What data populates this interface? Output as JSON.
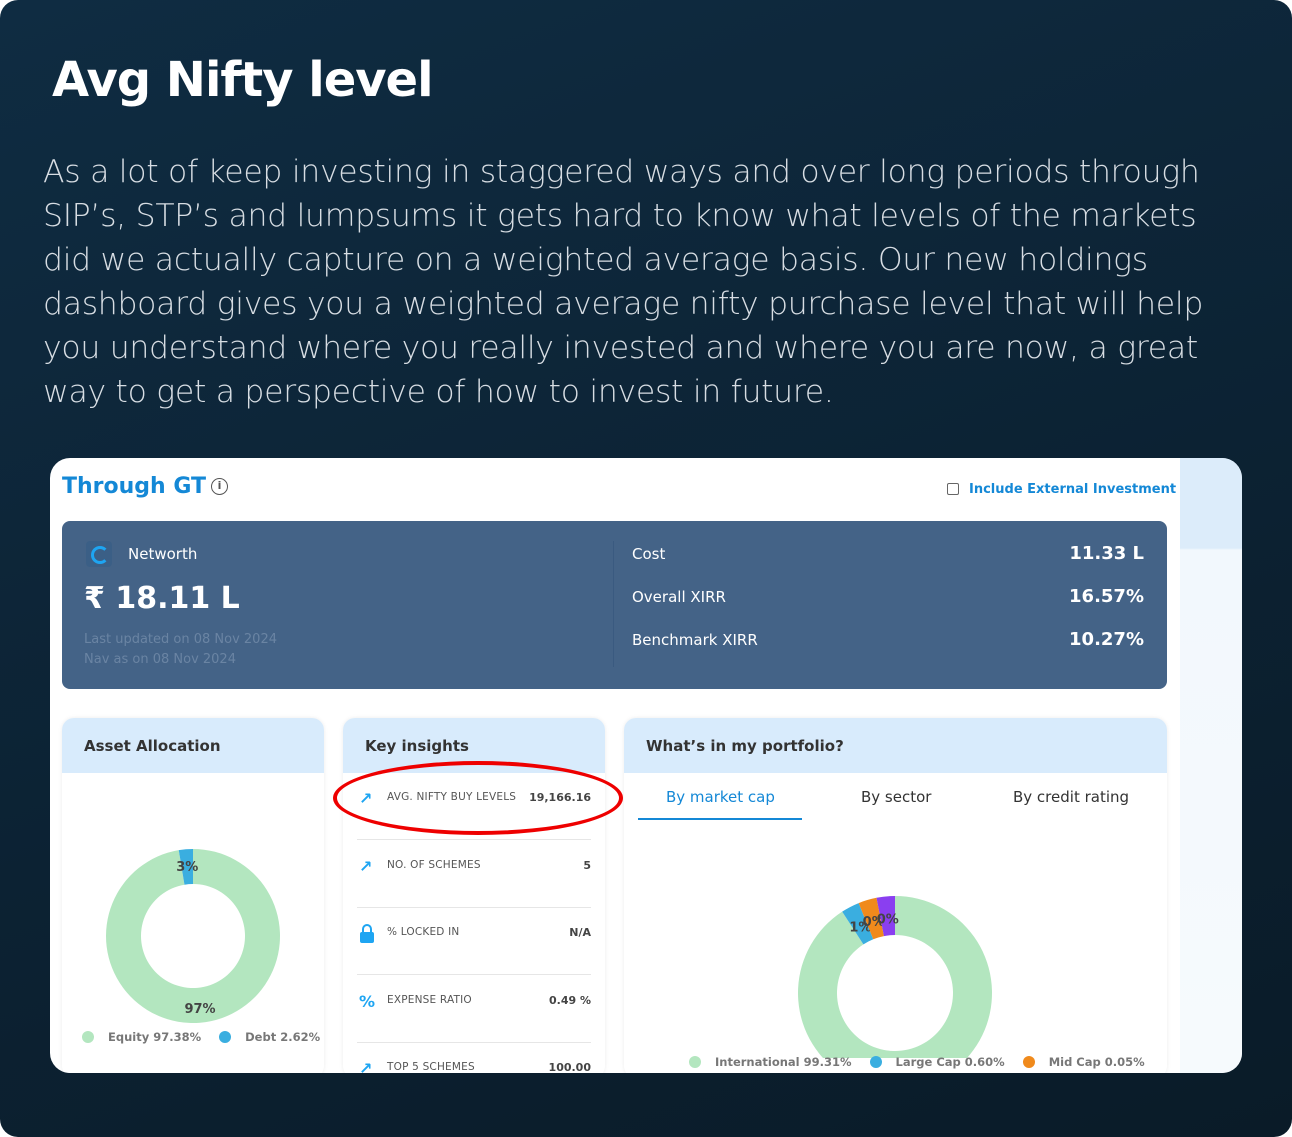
{
  "heading": "Avg Nifty level",
  "paragraph": "As a lot of keep investing in staggered ways and over long periods through SIP’s, STP’s and lumpsums it gets hard to know what levels of the markets did we actually capture on a weighted average basis. Our new holdings dashboard gives you a weighted average nifty purchase level that will help you understand where you really invested and where you are now, a great way to get a perspective of how to invest in future.",
  "card": {
    "title": "Through GT",
    "info_icon": "info-icon",
    "include_external": "Include External Investment",
    "include_external_checked": false,
    "networth": {
      "label": "Networth",
      "value": "₹ 18.11 L",
      "last_updated": "Last updated on 08 Nov 2024",
      "nav_as_on": "Nav as on 08 Nov 2024"
    },
    "stats": [
      {
        "label": "Cost",
        "value": "11.33 L"
      },
      {
        "label": "Overall XIRR",
        "value": "16.57%"
      },
      {
        "label": "Benchmark XIRR",
        "value": "10.27%"
      }
    ],
    "asset_allocation": {
      "title": "Asset Allocation"
    },
    "key_insights": {
      "title": "Key insights",
      "rows": [
        {
          "icon": "trending-up-icon",
          "label": "AVG. NIFTY BUY LEVELS",
          "value": "19,166.16"
        },
        {
          "icon": "trending-up-icon",
          "label": "NO. OF SCHEMES",
          "value": "5"
        },
        {
          "icon": "lock-icon",
          "label": "% LOCKED IN",
          "value": "N/A"
        },
        {
          "icon": "percent-icon",
          "label": "EXPENSE RATIO",
          "value": "0.49 %"
        },
        {
          "icon": "trending-up-icon",
          "label": "TOP 5 SCHEMES",
          "value": "100.00"
        }
      ]
    },
    "portfolio": {
      "title": "What’s in my portfolio?",
      "tabs": [
        "By market cap",
        "By sector",
        "By credit rating"
      ],
      "active_tab": 0
    }
  },
  "chart_data": [
    {
      "type": "pie",
      "donut": true,
      "slices": [
        {
          "name": "Equity",
          "value": 97.38,
          "label": "97%",
          "legend": "Equity 97.38%",
          "color": "#b3e6bf"
        },
        {
          "name": "Debt",
          "value": 2.62,
          "label": "3%",
          "legend": "Debt 2.62%",
          "color": "#3aaee0"
        }
      ]
    },
    {
      "type": "pie",
      "donut": true,
      "slices": [
        {
          "name": "International",
          "value": 99.31,
          "label": "99%",
          "legend": "International 99.31%",
          "color": "#b3e6bf"
        },
        {
          "name": "Large Cap",
          "value": 0.6,
          "label": "1%",
          "legend": "Large Cap 0.60%",
          "color": "#3aaee0"
        },
        {
          "name": "Mid Cap",
          "value": 0.05,
          "label": "0%",
          "legend": "Mid Cap 0.05%",
          "color": "#f08a1c"
        },
        {
          "value": 0.04,
          "label": "0%",
          "color": "#8a3ff0"
        }
      ]
    }
  ]
}
